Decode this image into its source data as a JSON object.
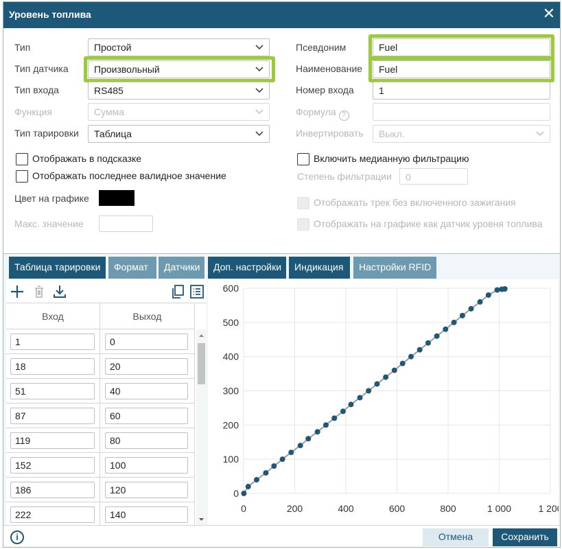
{
  "dialog": {
    "title": "Уровень топлива"
  },
  "form": {
    "type_label": "Тип",
    "type_value": "Простой",
    "sensor_type_label": "Тип датчика",
    "sensor_type_value": "Произвольный",
    "input_type_label": "Тип входа",
    "input_type_value": "RS485",
    "function_label": "Функция",
    "function_value": "Сумма",
    "calibration_type_label": "Тип тарировки",
    "calibration_type_value": "Таблица",
    "alias_label": "Псевдоним",
    "alias_value": "Fuel",
    "name_label": "Наименование",
    "name_value": "Fuel",
    "input_number_label": "Номер входа",
    "input_number_value": "1",
    "formula_label": "Формула",
    "invert_label": "Инвертировать",
    "invert_value": "Выкл.",
    "show_in_tooltip": "Отображать в подсказке",
    "show_last_valid": "Отображать последнее валидное значение",
    "enable_median": "Включить медианную фильтрацию",
    "filter_degree_label": "Степень фильтрации",
    "filter_degree_value": "0",
    "graph_color_label": "Цвет на графике",
    "graph_color": "#000000",
    "max_value_label": "Макс. значение",
    "max_value": "",
    "show_track_no_ignition": "Отображать трек без включенного зажигания",
    "show_as_fuel_sensor": "Отображать на графике как датчик уровня топлива"
  },
  "tabs": [
    {
      "label": "Таблица тарировки"
    },
    {
      "label": "Формат"
    },
    {
      "label": "Датчики"
    },
    {
      "label": "Доп. настройки"
    },
    {
      "label": "Индикация"
    },
    {
      "label": "Настройки RFID"
    }
  ],
  "table": {
    "col_in": "Вход",
    "col_out": "Выход",
    "rows": [
      {
        "in": "1",
        "out": "0"
      },
      {
        "in": "18",
        "out": "20"
      },
      {
        "in": "51",
        "out": "40"
      },
      {
        "in": "87",
        "out": "60"
      },
      {
        "in": "119",
        "out": "80"
      },
      {
        "in": "152",
        "out": "100"
      },
      {
        "in": "186",
        "out": "120"
      },
      {
        "in": "222",
        "out": "140"
      }
    ]
  },
  "footer": {
    "cancel": "Отмена",
    "save": "Сохранить"
  },
  "colors": {
    "accent": "#1d5878",
    "highlight": "#9bcb3b",
    "tab_light": "#6e9ab0",
    "point": "#1d5878"
  },
  "chart_data": {
    "type": "line",
    "x": [
      1,
      18,
      51,
      87,
      119,
      152,
      186,
      222,
      253,
      289,
      322,
      355,
      389,
      420,
      455,
      489,
      522,
      556,
      590,
      622,
      655,
      689,
      722,
      756,
      790,
      823,
      856,
      890,
      925,
      958,
      992,
      1010,
      1022
    ],
    "y": [
      0,
      20,
      40,
      60,
      80,
      100,
      120,
      140,
      160,
      180,
      200,
      220,
      240,
      260,
      280,
      300,
      320,
      340,
      360,
      380,
      400,
      420,
      440,
      460,
      480,
      500,
      520,
      540,
      560,
      580,
      595,
      597,
      598
    ],
    "x_ticks": [
      "0",
      "200",
      "400",
      "600",
      "800",
      "1 000",
      "1 200"
    ],
    "y_ticks": [
      "0",
      "100",
      "200",
      "300",
      "400",
      "500",
      "600"
    ],
    "xlim": [
      0,
      1200
    ],
    "ylim": [
      0,
      600
    ],
    "grid": true
  }
}
